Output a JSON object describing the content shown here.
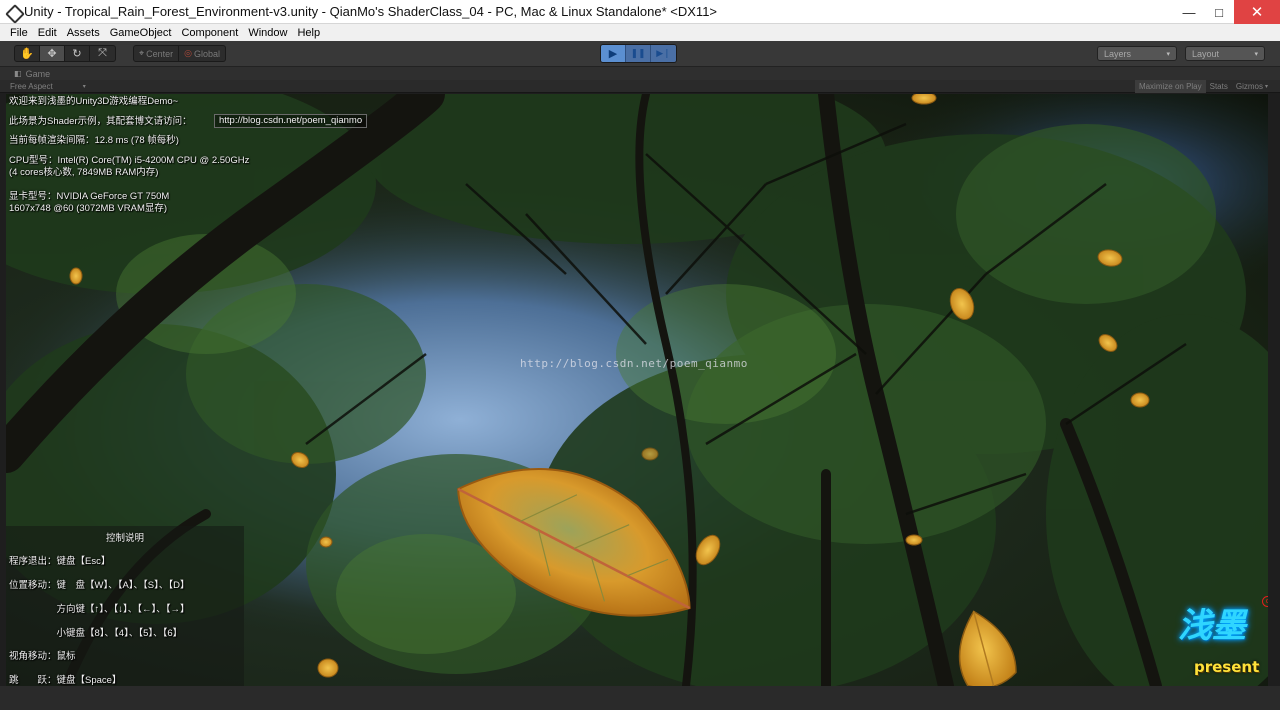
{
  "window": {
    "title": "Unity - Tropical_Rain_Forest_Environment-v3.unity - QianMo's ShaderClass_04 - PC, Mac & Linux Standalone* <DX11>",
    "minimize_glyph": "—",
    "maximize_glyph": "□",
    "close_glyph": "✕"
  },
  "menu": [
    "File",
    "Edit",
    "Assets",
    "GameObject",
    "Component",
    "Window",
    "Help"
  ],
  "toolbar": {
    "tools": [
      {
        "icon": "hand-icon",
        "glyph": "✋",
        "active": false
      },
      {
        "icon": "move-icon",
        "glyph": "✥",
        "active": true
      },
      {
        "icon": "rotate-icon",
        "glyph": "↻",
        "active": false
      },
      {
        "icon": "scale-icon",
        "glyph": "⤧",
        "active": false
      }
    ],
    "pivot_center_label": "Center",
    "pivot_global_label": "Global",
    "pivot_center_glyph": "⌖",
    "pivot_global_glyph": "◎",
    "play_glyph": "▶",
    "pause_glyph": "❚❚",
    "step_glyph": "▶❘",
    "layers_label": "Layers",
    "layout_label": "Layout",
    "dropdown_arrow": "▾"
  },
  "game_panel": {
    "tab_label": "Game",
    "tab_glyph": "◧",
    "aspect_label": "Free Aspect",
    "aspect_arrow": "▾",
    "maximize_on_play": "Maximize on Play",
    "stats": "Stats",
    "gizmos": "Gizmos",
    "gizmos_arrow": "▾"
  },
  "overlay": {
    "welcome": "欢迎来到浅墨的Unity3D游戏编程Demo~",
    "example_prefix": "此场景为Shader示例，其配套博文请访问：",
    "url": "http://blog.csdn.net/poem_qianmo",
    "frame_time": "当前每帧渲染间隔：12.8 ms (78 帧每秒)",
    "cpu_line1": "CPU型号：Intel(R) Core(TM) i5-4200M CPU @ 2.50GHz",
    "cpu_line2": "(4 cores核心数, 7849MB RAM内存)",
    "gpu_line1": "显卡型号：NVIDIA GeForce GT 750M",
    "gpu_line2": "1607x748 @60 (3072MB VRAM显存)",
    "watermark": "http://blog.csdn.net/poem_qianmo"
  },
  "controls": {
    "title": "控制说明",
    "rows": [
      "程序退出：键盘【Esc】",
      "位置移动：键　盘【W】、【A】、【S】、【D】",
      "　　　　　方向键【↑】、【↓】、【←】、【→】",
      "　　　　　小键盘【8】、【4】、【5】、【6】",
      "视角移动：鼠标",
      "跳　　跃：键盘【Space】"
    ]
  },
  "logo": {
    "cn": "浅墨",
    "en": "present",
    "copyright_glyph": "c"
  },
  "colors": {
    "play_active": "#5b8fd1",
    "close_button": "#e04343",
    "logo_cyan": "#2fd5ff",
    "logo_yellow": "#ffe23a"
  }
}
